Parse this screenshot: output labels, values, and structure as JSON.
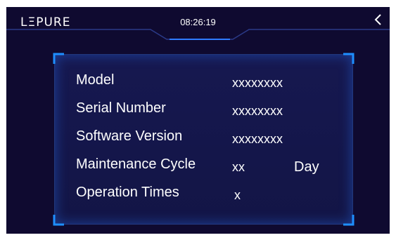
{
  "header": {
    "logo": "LΞPURE",
    "time": "08:26:19",
    "back_icon": "chevron-left-icon"
  },
  "info": {
    "model_label": "Model",
    "model_value": "xxxxxxxx",
    "serial_label": "Serial Number",
    "serial_value": "xxxxxxxx",
    "software_label": "Software Version",
    "software_value": "xxxxxxxx",
    "maintenance_label": "Maintenance Cycle",
    "maintenance_value": "xx",
    "maintenance_unit": "Day",
    "operation_label": "Operation Times",
    "operation_value": "x"
  },
  "colors": {
    "background": "#0f0a30",
    "accent": "#1e8fff",
    "text": "#ffffff"
  }
}
